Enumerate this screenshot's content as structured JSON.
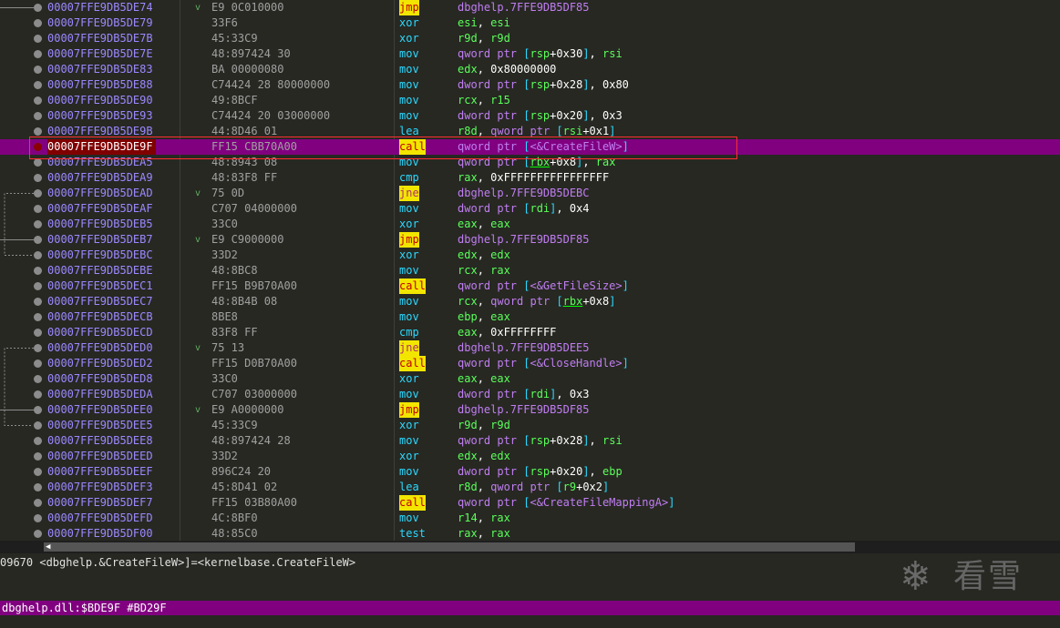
{
  "rows": [
    {
      "addr": "00007FFE9DB5DE74",
      "jm": "v",
      "bytes": "E9 0C010000",
      "mn": "jmp",
      "mt": "jmp",
      "ops": [
        [
          "dbghelp.7FFE9DB5DF85",
          "sym"
        ]
      ]
    },
    {
      "addr": "00007FFE9DB5DE79",
      "jm": "",
      "bytes": "33F6",
      "mn": "xor",
      "mt": "",
      "ops": [
        [
          "esi",
          "reg"
        ],
        [
          ", ",
          "plain"
        ],
        [
          "esi",
          "reg"
        ]
      ]
    },
    {
      "addr": "00007FFE9DB5DE7B",
      "jm": "",
      "bytes": "45:33C9",
      "mn": "xor",
      "mt": "",
      "ops": [
        [
          "r9d",
          "reg"
        ],
        [
          ", ",
          "plain"
        ],
        [
          "r9d",
          "reg"
        ]
      ]
    },
    {
      "addr": "00007FFE9DB5DE7E",
      "jm": "",
      "bytes": "48:897424 30",
      "mn": "mov",
      "mt": "",
      "ops": [
        [
          "qword ptr ",
          "sz"
        ],
        [
          "[",
          "brk"
        ],
        [
          "rsp",
          "reg"
        ],
        [
          "+",
          "plain"
        ],
        [
          "0x30",
          "num"
        ],
        [
          "]",
          "brk"
        ],
        [
          ", ",
          "plain"
        ],
        [
          "rsi",
          "reg"
        ]
      ]
    },
    {
      "addr": "00007FFE9DB5DE83",
      "jm": "",
      "bytes": "BA 00000080",
      "mn": "mov",
      "mt": "",
      "ops": [
        [
          "edx",
          "reg"
        ],
        [
          ", ",
          "plain"
        ],
        [
          "0x80000000",
          "num"
        ]
      ]
    },
    {
      "addr": "00007FFE9DB5DE88",
      "jm": "",
      "bytes": "C74424 28 80000000",
      "mn": "mov",
      "mt": "",
      "ops": [
        [
          "dword ptr ",
          "sz"
        ],
        [
          "[",
          "brk"
        ],
        [
          "rsp",
          "reg"
        ],
        [
          "+",
          "plain"
        ],
        [
          "0x28",
          "num"
        ],
        [
          "]",
          "brk"
        ],
        [
          ", ",
          "plain"
        ],
        [
          "0x80",
          "num"
        ]
      ]
    },
    {
      "addr": "00007FFE9DB5DE90",
      "jm": "",
      "bytes": "49:8BCF",
      "mn": "mov",
      "mt": "",
      "ops": [
        [
          "rcx",
          "reg"
        ],
        [
          ", ",
          "plain"
        ],
        [
          "r15",
          "reg"
        ]
      ]
    },
    {
      "addr": "00007FFE9DB5DE93",
      "jm": "",
      "bytes": "C74424 20 03000000",
      "mn": "mov",
      "mt": "",
      "ops": [
        [
          "dword ptr ",
          "sz"
        ],
        [
          "[",
          "brk"
        ],
        [
          "rsp",
          "reg"
        ],
        [
          "+",
          "plain"
        ],
        [
          "0x20",
          "num"
        ],
        [
          "]",
          "brk"
        ],
        [
          ", ",
          "plain"
        ],
        [
          "0x3",
          "num"
        ]
      ]
    },
    {
      "addr": "00007FFE9DB5DE9B",
      "jm": "",
      "bytes": "44:8D46 01",
      "mn": "lea",
      "mt": "",
      "ops": [
        [
          "r8d",
          "reg"
        ],
        [
          ", ",
          "plain"
        ],
        [
          "qword ptr ",
          "sz"
        ],
        [
          "[",
          "brk"
        ],
        [
          "rsi",
          "reg"
        ],
        [
          "+",
          "plain"
        ],
        [
          "0x1",
          "num"
        ],
        [
          "]",
          "brk"
        ]
      ]
    },
    {
      "addr": "00007FFE9DB5DE9F",
      "jm": "",
      "bytes": "FF15 CBB70A00",
      "mn": "call",
      "mt": "call",
      "sel": true,
      "ops": [
        [
          "qword ptr ",
          "sz"
        ],
        [
          "[",
          "brk"
        ],
        [
          "<&CreateFileW>",
          "sym"
        ],
        [
          "]",
          "brk"
        ]
      ]
    },
    {
      "addr": "00007FFE9DB5DEA5",
      "jm": "",
      "bytes": "48:8943 08",
      "mn": "mov",
      "mt": "",
      "ops": [
        [
          "qword ptr ",
          "sz"
        ],
        [
          "[",
          "brk"
        ],
        [
          "rbx",
          "reg u"
        ],
        [
          "+",
          "plain"
        ],
        [
          "0x8",
          "num"
        ],
        [
          "]",
          "brk"
        ],
        [
          ", ",
          "plain"
        ],
        [
          "rax",
          "reg"
        ]
      ]
    },
    {
      "addr": "00007FFE9DB5DEA9",
      "jm": "",
      "bytes": "48:83F8 FF",
      "mn": "cmp",
      "mt": "",
      "ops": [
        [
          "rax",
          "reg"
        ],
        [
          ", ",
          "plain"
        ],
        [
          "0xFFFFFFFFFFFFFFFF",
          "num"
        ]
      ]
    },
    {
      "addr": "00007FFE9DB5DEAD",
      "jm": "v",
      "bytes": "75 0D",
      "mn": "jne",
      "mt": "jcc",
      "ops": [
        [
          "dbghelp.7FFE9DB5DEBC",
          "sym"
        ]
      ]
    },
    {
      "addr": "00007FFE9DB5DEAF",
      "jm": "",
      "bytes": "C707 04000000",
      "mn": "mov",
      "mt": "",
      "ops": [
        [
          "dword ptr ",
          "sz"
        ],
        [
          "[",
          "brk"
        ],
        [
          "rdi",
          "reg"
        ],
        [
          "]",
          "brk"
        ],
        [
          ", ",
          "plain"
        ],
        [
          "0x4",
          "num"
        ]
      ]
    },
    {
      "addr": "00007FFE9DB5DEB5",
      "jm": "",
      "bytes": "33C0",
      "mn": "xor",
      "mt": "",
      "ops": [
        [
          "eax",
          "reg"
        ],
        [
          ", ",
          "plain"
        ],
        [
          "eax",
          "reg"
        ]
      ]
    },
    {
      "addr": "00007FFE9DB5DEB7",
      "jm": "v",
      "bytes": "E9 C9000000",
      "mn": "jmp",
      "mt": "jmp",
      "ops": [
        [
          "dbghelp.7FFE9DB5DF85",
          "sym"
        ]
      ]
    },
    {
      "addr": "00007FFE9DB5DEBC",
      "jm": "",
      "bytes": "33D2",
      "mn": "xor",
      "mt": "",
      "ops": [
        [
          "edx",
          "reg"
        ],
        [
          ", ",
          "plain"
        ],
        [
          "edx",
          "reg"
        ]
      ]
    },
    {
      "addr": "00007FFE9DB5DEBE",
      "jm": "",
      "bytes": "48:8BC8",
      "mn": "mov",
      "mt": "",
      "ops": [
        [
          "rcx",
          "reg"
        ],
        [
          ", ",
          "plain"
        ],
        [
          "rax",
          "reg"
        ]
      ]
    },
    {
      "addr": "00007FFE9DB5DEC1",
      "jm": "",
      "bytes": "FF15 B9B70A00",
      "mn": "call",
      "mt": "call",
      "ops": [
        [
          "qword ptr ",
          "sz"
        ],
        [
          "[",
          "brk"
        ],
        [
          "<&GetFileSize>",
          "sym"
        ],
        [
          "]",
          "brk"
        ]
      ]
    },
    {
      "addr": "00007FFE9DB5DEC7",
      "jm": "",
      "bytes": "48:8B4B 08",
      "mn": "mov",
      "mt": "",
      "ops": [
        [
          "rcx",
          "reg"
        ],
        [
          ", ",
          "plain"
        ],
        [
          "qword ptr ",
          "sz"
        ],
        [
          "[",
          "brk"
        ],
        [
          "rbx",
          "reg u"
        ],
        [
          "+",
          "plain"
        ],
        [
          "0x8",
          "num"
        ],
        [
          "]",
          "brk"
        ]
      ]
    },
    {
      "addr": "00007FFE9DB5DECB",
      "jm": "",
      "bytes": "8BE8",
      "mn": "mov",
      "mt": "",
      "ops": [
        [
          "ebp",
          "reg"
        ],
        [
          ", ",
          "plain"
        ],
        [
          "eax",
          "reg"
        ]
      ]
    },
    {
      "addr": "00007FFE9DB5DECD",
      "jm": "",
      "bytes": "83F8 FF",
      "mn": "cmp",
      "mt": "",
      "ops": [
        [
          "eax",
          "reg"
        ],
        [
          ", ",
          "plain"
        ],
        [
          "0xFFFFFFFF",
          "num"
        ]
      ]
    },
    {
      "addr": "00007FFE9DB5DED0",
      "jm": "v",
      "bytes": "75 13",
      "mn": "jne",
      "mt": "jcc",
      "ops": [
        [
          "dbghelp.7FFE9DB5DEE5",
          "sym"
        ]
      ]
    },
    {
      "addr": "00007FFE9DB5DED2",
      "jm": "",
      "bytes": "FF15 D0B70A00",
      "mn": "call",
      "mt": "call",
      "ops": [
        [
          "qword ptr ",
          "sz"
        ],
        [
          "[",
          "brk"
        ],
        [
          "<&CloseHandle>",
          "sym"
        ],
        [
          "]",
          "brk"
        ]
      ]
    },
    {
      "addr": "00007FFE9DB5DED8",
      "jm": "",
      "bytes": "33C0",
      "mn": "xor",
      "mt": "",
      "ops": [
        [
          "eax",
          "reg"
        ],
        [
          ", ",
          "plain"
        ],
        [
          "eax",
          "reg"
        ]
      ]
    },
    {
      "addr": "00007FFE9DB5DEDA",
      "jm": "",
      "bytes": "C707 03000000",
      "mn": "mov",
      "mt": "",
      "ops": [
        [
          "dword ptr ",
          "sz"
        ],
        [
          "[",
          "brk"
        ],
        [
          "rdi",
          "reg"
        ],
        [
          "]",
          "brk"
        ],
        [
          ", ",
          "plain"
        ],
        [
          "0x3",
          "num"
        ]
      ]
    },
    {
      "addr": "00007FFE9DB5DEE0",
      "jm": "v",
      "bytes": "E9 A0000000",
      "mn": "jmp",
      "mt": "jmp",
      "ops": [
        [
          "dbghelp.7FFE9DB5DF85",
          "sym"
        ]
      ]
    },
    {
      "addr": "00007FFE9DB5DEE5",
      "jm": "",
      "bytes": "45:33C9",
      "mn": "xor",
      "mt": "",
      "ops": [
        [
          "r9d",
          "reg"
        ],
        [
          ", ",
          "plain"
        ],
        [
          "r9d",
          "reg"
        ]
      ]
    },
    {
      "addr": "00007FFE9DB5DEE8",
      "jm": "",
      "bytes": "48:897424 28",
      "mn": "mov",
      "mt": "",
      "ops": [
        [
          "qword ptr ",
          "sz"
        ],
        [
          "[",
          "brk"
        ],
        [
          "rsp",
          "reg"
        ],
        [
          "+",
          "plain"
        ],
        [
          "0x28",
          "num"
        ],
        [
          "]",
          "brk"
        ],
        [
          ", ",
          "plain"
        ],
        [
          "rsi",
          "reg"
        ]
      ]
    },
    {
      "addr": "00007FFE9DB5DEED",
      "jm": "",
      "bytes": "33D2",
      "mn": "xor",
      "mt": "",
      "ops": [
        [
          "edx",
          "reg"
        ],
        [
          ", ",
          "plain"
        ],
        [
          "edx",
          "reg"
        ]
      ]
    },
    {
      "addr": "00007FFE9DB5DEEF",
      "jm": "",
      "bytes": "896C24 20",
      "mn": "mov",
      "mt": "",
      "ops": [
        [
          "dword ptr ",
          "sz"
        ],
        [
          "[",
          "brk"
        ],
        [
          "rsp",
          "reg"
        ],
        [
          "+",
          "plain"
        ],
        [
          "0x20",
          "num"
        ],
        [
          "]",
          "brk"
        ],
        [
          ", ",
          "plain"
        ],
        [
          "ebp",
          "reg"
        ]
      ]
    },
    {
      "addr": "00007FFE9DB5DEF3",
      "jm": "",
      "bytes": "45:8D41 02",
      "mn": "lea",
      "mt": "",
      "ops": [
        [
          "r8d",
          "reg"
        ],
        [
          ", ",
          "plain"
        ],
        [
          "qword ptr ",
          "sz"
        ],
        [
          "[",
          "brk"
        ],
        [
          "r9",
          "reg"
        ],
        [
          "+",
          "plain"
        ],
        [
          "0x2",
          "num"
        ],
        [
          "]",
          "brk"
        ]
      ]
    },
    {
      "addr": "00007FFE9DB5DEF7",
      "jm": "",
      "bytes": "FF15 03B80A00",
      "mn": "call",
      "mt": "call",
      "ops": [
        [
          "qword ptr ",
          "sz"
        ],
        [
          "[",
          "brk"
        ],
        [
          "<&CreateFileMappingA>",
          "sym"
        ],
        [
          "]",
          "brk"
        ]
      ]
    },
    {
      "addr": "00007FFE9DB5DEFD",
      "jm": "",
      "bytes": "4C:8BF0",
      "mn": "mov",
      "mt": "",
      "ops": [
        [
          "r14",
          "reg"
        ],
        [
          ", ",
          "plain"
        ],
        [
          "rax",
          "reg"
        ]
      ]
    },
    {
      "addr": "00007FFE9DB5DF00",
      "jm": "",
      "bytes": "48:85C0",
      "mn": "test",
      "mt": "",
      "ops": [
        [
          "rax",
          "reg"
        ],
        [
          ", ",
          "plain"
        ],
        [
          "rax",
          "reg"
        ]
      ]
    }
  ],
  "info": {
    "line1": "09670 <dbghelp.&CreateFileW>]=<kernelbase.CreateFileW>"
  },
  "watermark": {
    "symbol": "❄",
    "text": "看雪"
  },
  "status": {
    "text": "dbghelp.dll:$BDE9F #BD29F"
  },
  "scrollbar": {
    "arrow": "◀"
  },
  "colors": {
    "background": "#272822",
    "selected_row": "#800080",
    "address": "#9b88ff",
    "mnemonic": "#2bd9ff",
    "jump_call_highlight": "#f2e600",
    "register": "#5bff5b",
    "symbol": "#c07ef2",
    "highlight_box": "#ff3030"
  }
}
